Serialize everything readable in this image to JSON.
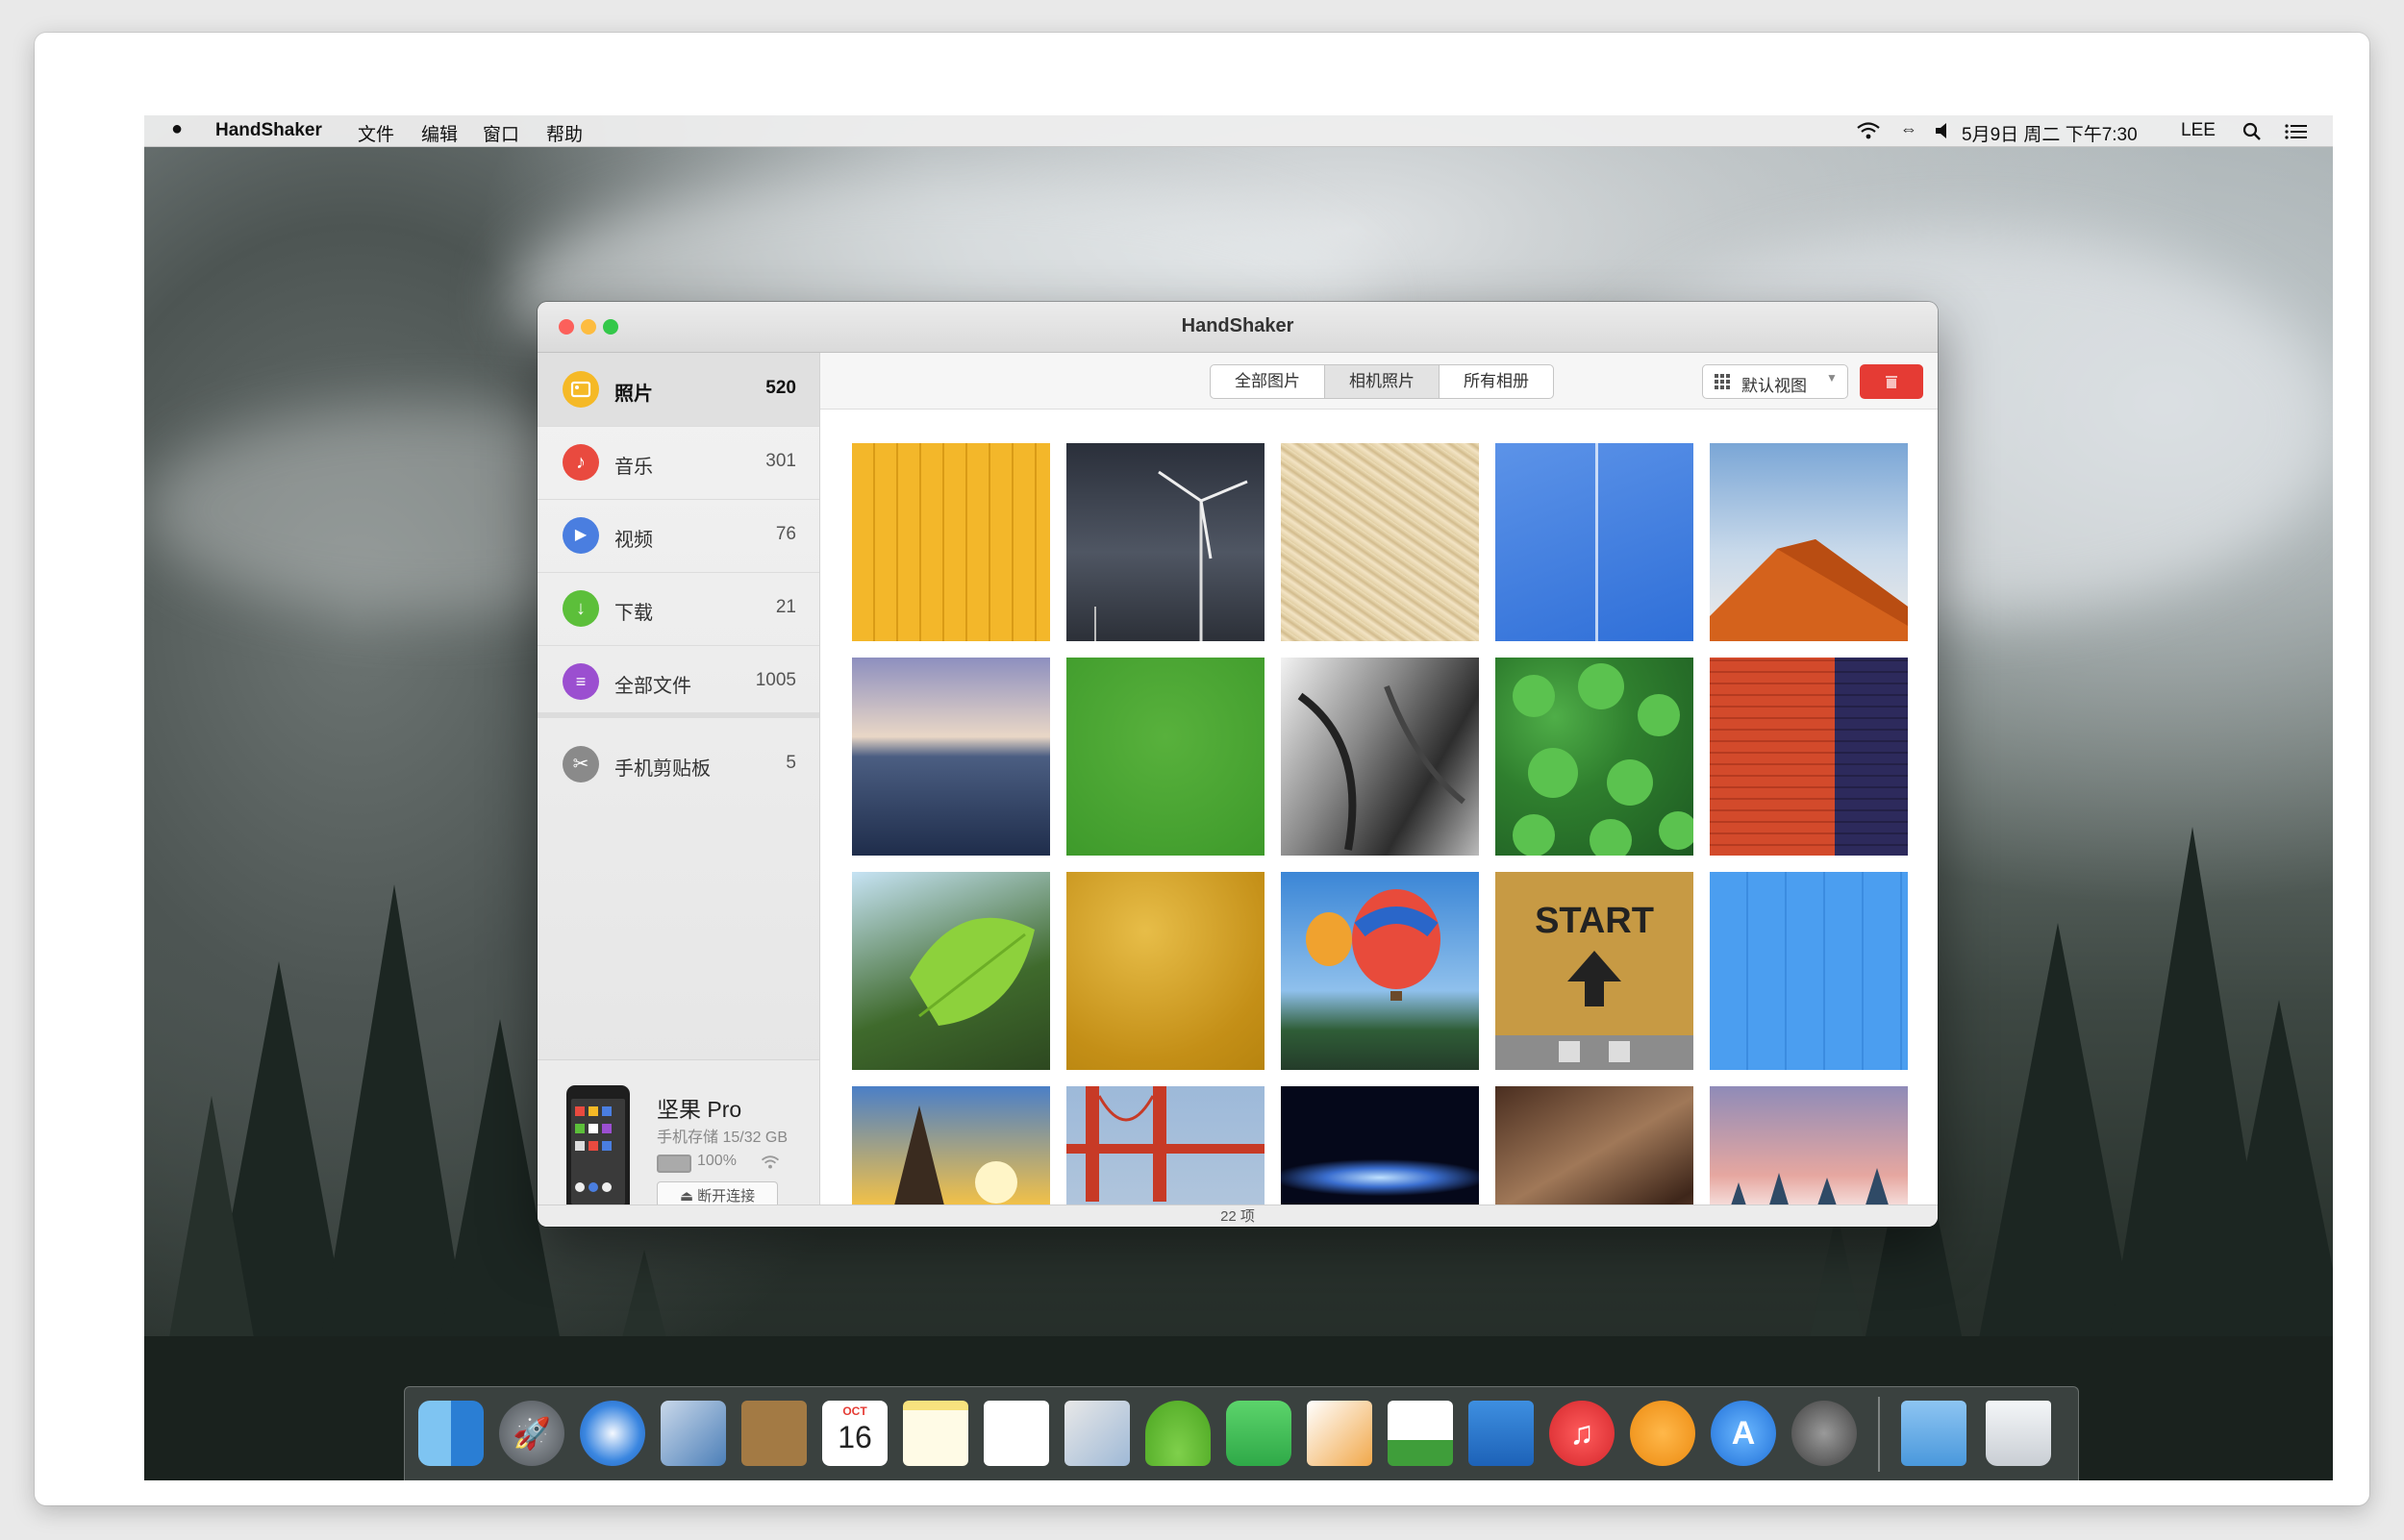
{
  "menubar": {
    "app_name": "HandShaker",
    "menus": [
      "文件",
      "编辑",
      "窗口",
      "帮助"
    ],
    "datetime": "5月9日 周二 下午7:30",
    "user": "LEE"
  },
  "window": {
    "title": "HandShaker"
  },
  "sidebar": {
    "items": [
      {
        "label": "照片",
        "count": "520",
        "icon": "photo-icon",
        "color": "#f5b926"
      },
      {
        "label": "音乐",
        "count": "301",
        "icon": "music-icon",
        "color": "#e94a3f"
      },
      {
        "label": "视频",
        "count": "76",
        "icon": "video-icon",
        "color": "#4a7ee0"
      },
      {
        "label": "下载",
        "count": "21",
        "icon": "download-icon",
        "color": "#5cbf3a"
      },
      {
        "label": "全部文件",
        "count": "1005",
        "icon": "files-icon",
        "color": "#9b4fd0"
      },
      {
        "label": "手机剪贴板",
        "count": "5",
        "icon": "clipboard-icon",
        "color": "#8a8a8a"
      }
    ]
  },
  "device": {
    "name": "坚果 Pro",
    "storage": "手机存储 15/32 GB",
    "battery": "100%",
    "disconnect_label": "断开连接"
  },
  "toolbar": {
    "segments": [
      "全部图片",
      "相机照片",
      "所有相册"
    ],
    "active_segment": "相机照片",
    "view_label": "默认视图"
  },
  "grid": {
    "tiles": [
      "yellow-siding",
      "wind-turbine",
      "straw",
      "blue-sky-contrail",
      "red-dune",
      "ocean-dusk",
      "green-fabric",
      "elephant",
      "forest-aerial",
      "red-navy-wall",
      "green-leaf",
      "gold-texture",
      "hot-air-balloons",
      "start-arrow",
      "blue-wall",
      "sunset-sail",
      "golden-gate",
      "earth-horizon",
      "brown-fabric",
      "snow-forest"
    ],
    "start_text": "START"
  },
  "status": {
    "count_text": "22 项"
  },
  "dock": {
    "calendar_month": "OCT",
    "calendar_day": "16",
    "apps": [
      "finder",
      "launchpad",
      "safari",
      "mail",
      "contacts",
      "calendar",
      "notes",
      "reminders",
      "preview",
      "android",
      "facetime",
      "pages",
      "numbers",
      "keynote",
      "itunes",
      "ibooks",
      "app-store",
      "system-preferences",
      "downloads",
      "trash"
    ]
  },
  "colors": {
    "accent_delete": "#e53b34",
    "close": "#fc605b",
    "minimize": "#fdbc40",
    "zoom": "#34c84a"
  }
}
